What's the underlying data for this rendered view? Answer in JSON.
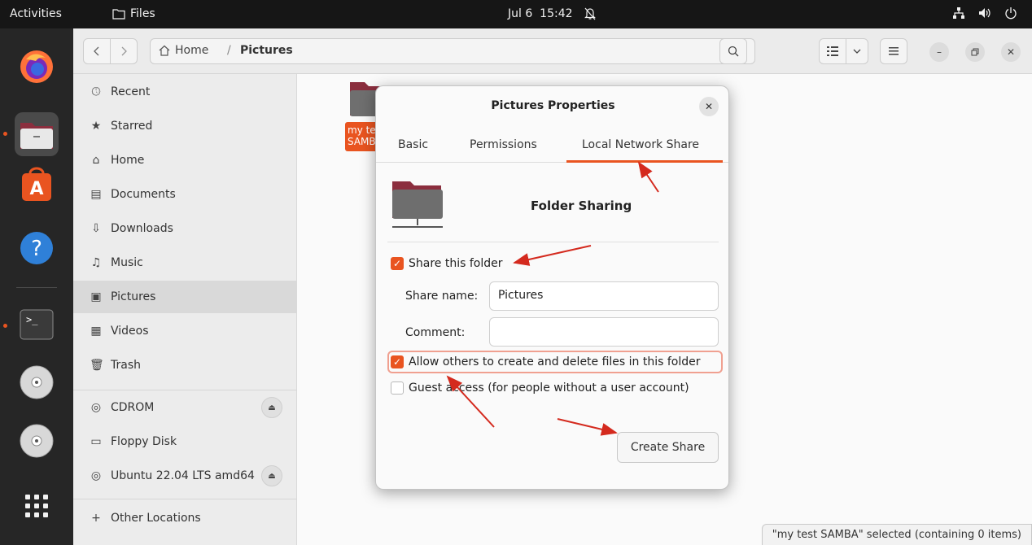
{
  "topbar": {
    "activities": "Activities",
    "app_name": "Files",
    "clock_date": "Jul 6",
    "clock_time": "15:42"
  },
  "dock": {
    "items": [
      "firefox-icon",
      "files-icon",
      "app-center-icon",
      "help-icon",
      "terminal-icon",
      "cdrom-icon",
      "disc-icon",
      "app-grid-icon"
    ]
  },
  "header": {
    "path_home": "Home",
    "path_separator": "/",
    "path_current": "Pictures"
  },
  "sidebar": {
    "items": [
      {
        "label": "Recent",
        "icon": "clock-icon"
      },
      {
        "label": "Starred",
        "icon": "star-icon"
      },
      {
        "label": "Home",
        "icon": "home-icon"
      },
      {
        "label": "Documents",
        "icon": "document-icon"
      },
      {
        "label": "Downloads",
        "icon": "download-icon"
      },
      {
        "label": "Music",
        "icon": "music-icon"
      },
      {
        "label": "Pictures",
        "icon": "picture-icon"
      },
      {
        "label": "Videos",
        "icon": "video-icon"
      },
      {
        "label": "Trash",
        "icon": "trash-icon"
      }
    ],
    "devices": [
      {
        "label": "CDROM",
        "icon": "disc-icon"
      },
      {
        "label": "Floppy Disk",
        "icon": "floppy-icon"
      },
      {
        "label": "Ubuntu 22.04 LTS amd64",
        "icon": "disc-icon"
      }
    ],
    "other_locations": "Other Locations"
  },
  "content": {
    "file_label": "my test SAMBA",
    "status": "\"my test SAMBA\" selected  (containing 0 items)"
  },
  "dialog": {
    "title": "Pictures Properties",
    "tabs": [
      "Basic",
      "Permissions",
      "Local Network Share"
    ],
    "active_tab": "Local Network Share",
    "section_title": "Folder Sharing",
    "share_folder_label": "Share this folder",
    "share_folder_checked": true,
    "share_name_label": "Share name:",
    "share_name_value": "Pictures",
    "comment_label": "Comment:",
    "comment_value": "",
    "allow_others_label": "Allow others to create and delete files in this folder",
    "allow_others_checked": true,
    "guest_access_label": "Guest access (for people without a user account)",
    "guest_access_checked": false,
    "create_button": "Create Share"
  },
  "colors": {
    "accent": "#e95420",
    "annotation_arrow": "#d42a1e"
  }
}
